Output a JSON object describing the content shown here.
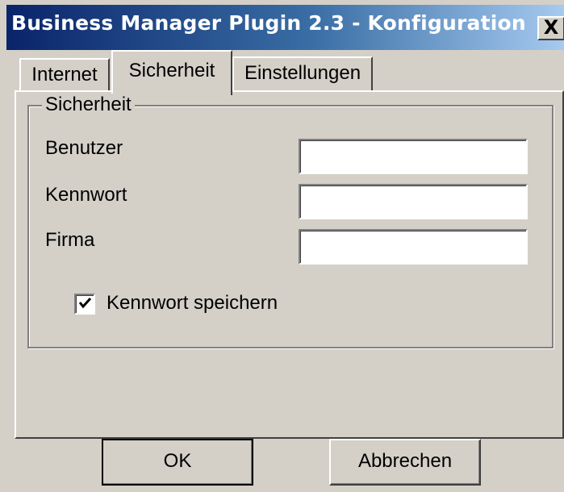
{
  "window": {
    "title": "Business Manager Plugin 2.3 - Konfiguration",
    "close_label": "X"
  },
  "tabs": [
    {
      "label": "Internet",
      "selected": false
    },
    {
      "label": "Sicherheit",
      "selected": true
    },
    {
      "label": "Einstellungen",
      "selected": false
    }
  ],
  "security": {
    "group_title": "Sicherheit",
    "user_label": "Benutzer",
    "user_value": "",
    "password_label": "Kennwort",
    "password_value": "",
    "company_label": "Firma",
    "company_value": "",
    "save_password_label": "Kennwort speichern",
    "save_password_checked": true
  },
  "buttons": {
    "ok_label": "OK",
    "cancel_label": "Abbrechen"
  },
  "icons": {
    "close": "close-icon",
    "checkmark": "checkmark-icon"
  },
  "colors": {
    "titlebar_start": "#0a246a",
    "titlebar_end": "#a6caf0",
    "face": "#d4d0c8"
  }
}
